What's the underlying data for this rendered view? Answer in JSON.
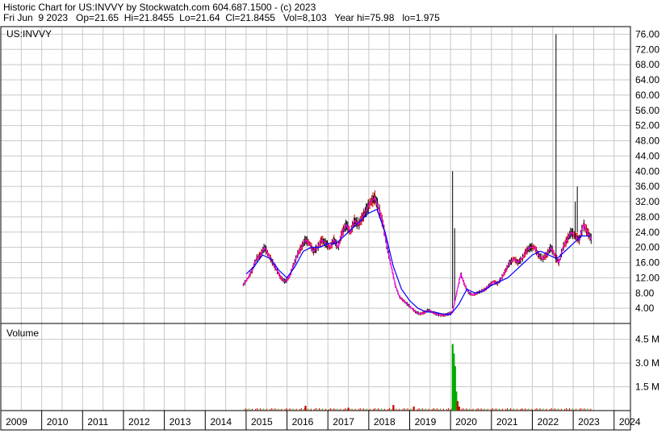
{
  "header": {
    "line1": "Historic Chart for US:INVVY by Stockwatch.com 604.687.1500 - (c) 2023",
    "line2": "Fri Jun  9 2023   Op=21.65  Hi=21.8455  Lo=21.64  Cl=21.8455   Vol=8,103   Year hi=75.98   lo=1.975"
  },
  "chart_data": {
    "type": "line",
    "symbol": "US:INVVY",
    "volume_label": "Volume",
    "price_axis": {
      "min": 0,
      "max": 78,
      "ticks": [
        "4.00",
        "8.00",
        "12.00",
        "16.00",
        "20.00",
        "24.00",
        "28.00",
        "32.00",
        "36.00",
        "40.00",
        "44.00",
        "48.00",
        "52.00",
        "56.00",
        "60.00",
        "64.00",
        "68.00",
        "72.00",
        "76.00"
      ]
    },
    "volume_axis": {
      "min": 0,
      "max": 5500000,
      "ticks": [
        "1.5 M",
        "3.0 M",
        "4.5 M"
      ]
    },
    "x_axis": {
      "min": 2009.0,
      "max": 2024.4,
      "labels": [
        "2009",
        "2010",
        "2011",
        "2012",
        "2013",
        "2014",
        "2015",
        "2016",
        "2017",
        "2018",
        "2019",
        "2020",
        "2021",
        "2022",
        "2023",
        "2024"
      ]
    },
    "grid": true,
    "colors": {
      "price": "#cc0000",
      "ma_short": "#ff00ff",
      "ma_long": "#0000ff",
      "spike": "#000000",
      "vol_up": "#00aa00",
      "vol_down": "#cc0000",
      "grid": "#c8c8c8"
    },
    "series": [
      {
        "x": [
          2014.92,
          2015.05,
          2015.15,
          2015.25,
          2015.35,
          2015.45,
          2015.55,
          2015.65,
          2015.75,
          2015.85,
          2015.95,
          2016.05,
          2016.15,
          2016.25,
          2016.35,
          2016.45,
          2016.55,
          2016.65,
          2016.75,
          2016.85,
          2016.95,
          2017.05,
          2017.15,
          2017.25,
          2017.35,
          2017.45,
          2017.55,
          2017.65,
          2017.75,
          2017.85,
          2017.95,
          2018.05,
          2018.15,
          2018.25,
          2018.35,
          2018.45,
          2018.55,
          2018.65,
          2018.75,
          2018.85,
          2018.95,
          2019.05,
          2019.15,
          2019.25,
          2019.35,
          2019.45,
          2019.55,
          2019.65,
          2019.75,
          2019.85,
          2019.95,
          2020.05,
          2020.15,
          2020.25,
          2020.35,
          2020.45,
          2020.55,
          2020.65,
          2020.75,
          2020.85,
          2020.95,
          2021.05,
          2021.15,
          2021.25,
          2021.35,
          2021.45,
          2021.55,
          2021.65,
          2021.75,
          2021.85,
          2021.95,
          2022.05,
          2022.15,
          2022.25,
          2022.35,
          2022.45,
          2022.55,
          2022.65,
          2022.75,
          2022.85,
          2022.95,
          2023.05,
          2023.15,
          2023.25,
          2023.35,
          2023.45
        ],
        "values": [
          10,
          12,
          14,
          17,
          18,
          20,
          18,
          16,
          14,
          12,
          11,
          12,
          15,
          18,
          20,
          22,
          21,
          19,
          20,
          22,
          21,
          20,
          22,
          20,
          24,
          26,
          24,
          27,
          26,
          28,
          30,
          32,
          33,
          30,
          26,
          20,
          15,
          10,
          7,
          6,
          5,
          4,
          3,
          2.5,
          2.8,
          3.5,
          3,
          2.5,
          2.2,
          2.2,
          2.5,
          3,
          8,
          13,
          10,
          8,
          7.5,
          8,
          8.5,
          9,
          10,
          11,
          10.5,
          12,
          14,
          16,
          17,
          16,
          17,
          19,
          20,
          20,
          18,
          17,
          18,
          20,
          18,
          16,
          20,
          22,
          24,
          23,
          22,
          26,
          24,
          22
        ]
      },
      {
        "x": [
          2015.0,
          2015.2,
          2015.4,
          2015.6,
          2015.8,
          2016.0,
          2016.2,
          2016.4,
          2016.6,
          2016.8,
          2017.0,
          2017.2,
          2017.4,
          2017.6,
          2017.8,
          2018.0,
          2018.2,
          2018.4,
          2018.6,
          2018.8,
          2019.0,
          2019.2,
          2019.4,
          2019.6,
          2019.8,
          2020.0,
          2020.2,
          2020.4,
          2020.6,
          2020.8,
          2021.0,
          2021.2,
          2021.4,
          2021.6,
          2021.8,
          2022.0,
          2022.2,
          2022.4,
          2022.6,
          2022.8,
          2023.0,
          2023.2,
          2023.4
        ],
        "values": [
          13,
          15,
          18,
          17,
          14,
          12,
          15,
          19,
          20,
          20,
          21,
          21,
          23,
          25,
          27,
          29,
          30,
          24,
          15,
          9,
          6,
          4,
          3,
          3,
          2.5,
          2.3,
          5,
          9,
          8,
          8.5,
          10,
          11,
          12,
          14,
          16,
          18,
          19,
          18,
          17,
          19,
          21,
          23,
          23
        ]
      }
    ],
    "spikes": [
      {
        "x": 2020.05,
        "low": 4,
        "high": 40
      },
      {
        "x": 2020.1,
        "low": 6,
        "high": 25
      },
      {
        "x": 2022.58,
        "low": 16,
        "high": 75.98
      },
      {
        "x": 2023.05,
        "low": 22,
        "high": 32
      },
      {
        "x": 2023.1,
        "low": 24,
        "high": 36
      }
    ],
    "volume": [
      {
        "x": 2020.05,
        "v": 4200000
      },
      {
        "x": 2020.08,
        "v": 3600000
      },
      {
        "x": 2020.11,
        "v": 2800000
      },
      {
        "x": 2020.14,
        "v": 1200000
      },
      {
        "x": 2020.17,
        "v": 600000
      },
      {
        "x": 2020.21,
        "v": 250000
      },
      {
        "x": 2018.6,
        "v": 350000
      },
      {
        "x": 2019.1,
        "v": 250000
      },
      {
        "x": 2016.45,
        "v": 300000
      },
      {
        "x": 2017.5,
        "v": 180000
      }
    ]
  }
}
